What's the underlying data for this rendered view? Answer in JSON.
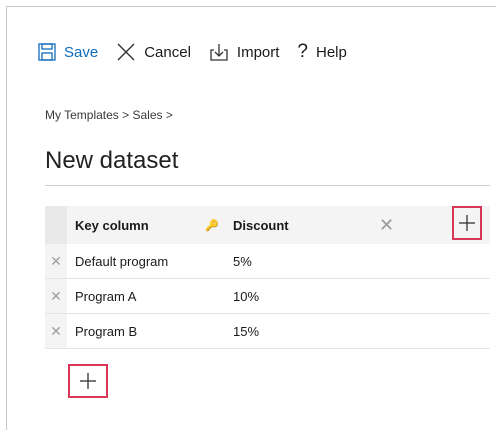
{
  "toolbar": {
    "save_label": "Save",
    "cancel_label": "Cancel",
    "import_label": "Import",
    "help_label": "Help",
    "help_glyph": "?"
  },
  "breadcrumb": "My Templates > Sales >",
  "page_title": "New dataset",
  "grid": {
    "headers": {
      "key_column": "Key column",
      "discount": "Discount"
    },
    "rows": [
      {
        "key": "Default program",
        "discount": "5%"
      },
      {
        "key": "Program A",
        "discount": "10%"
      },
      {
        "key": "Program B",
        "discount": "15%"
      }
    ]
  },
  "icons": {
    "save": "save-icon",
    "cancel": "close-icon",
    "import": "import-icon",
    "key": "key-icon",
    "remove": "close-icon",
    "add": "plus-icon"
  },
  "colors": {
    "accent": "#0f6cbd",
    "highlight": "#d9365a"
  }
}
